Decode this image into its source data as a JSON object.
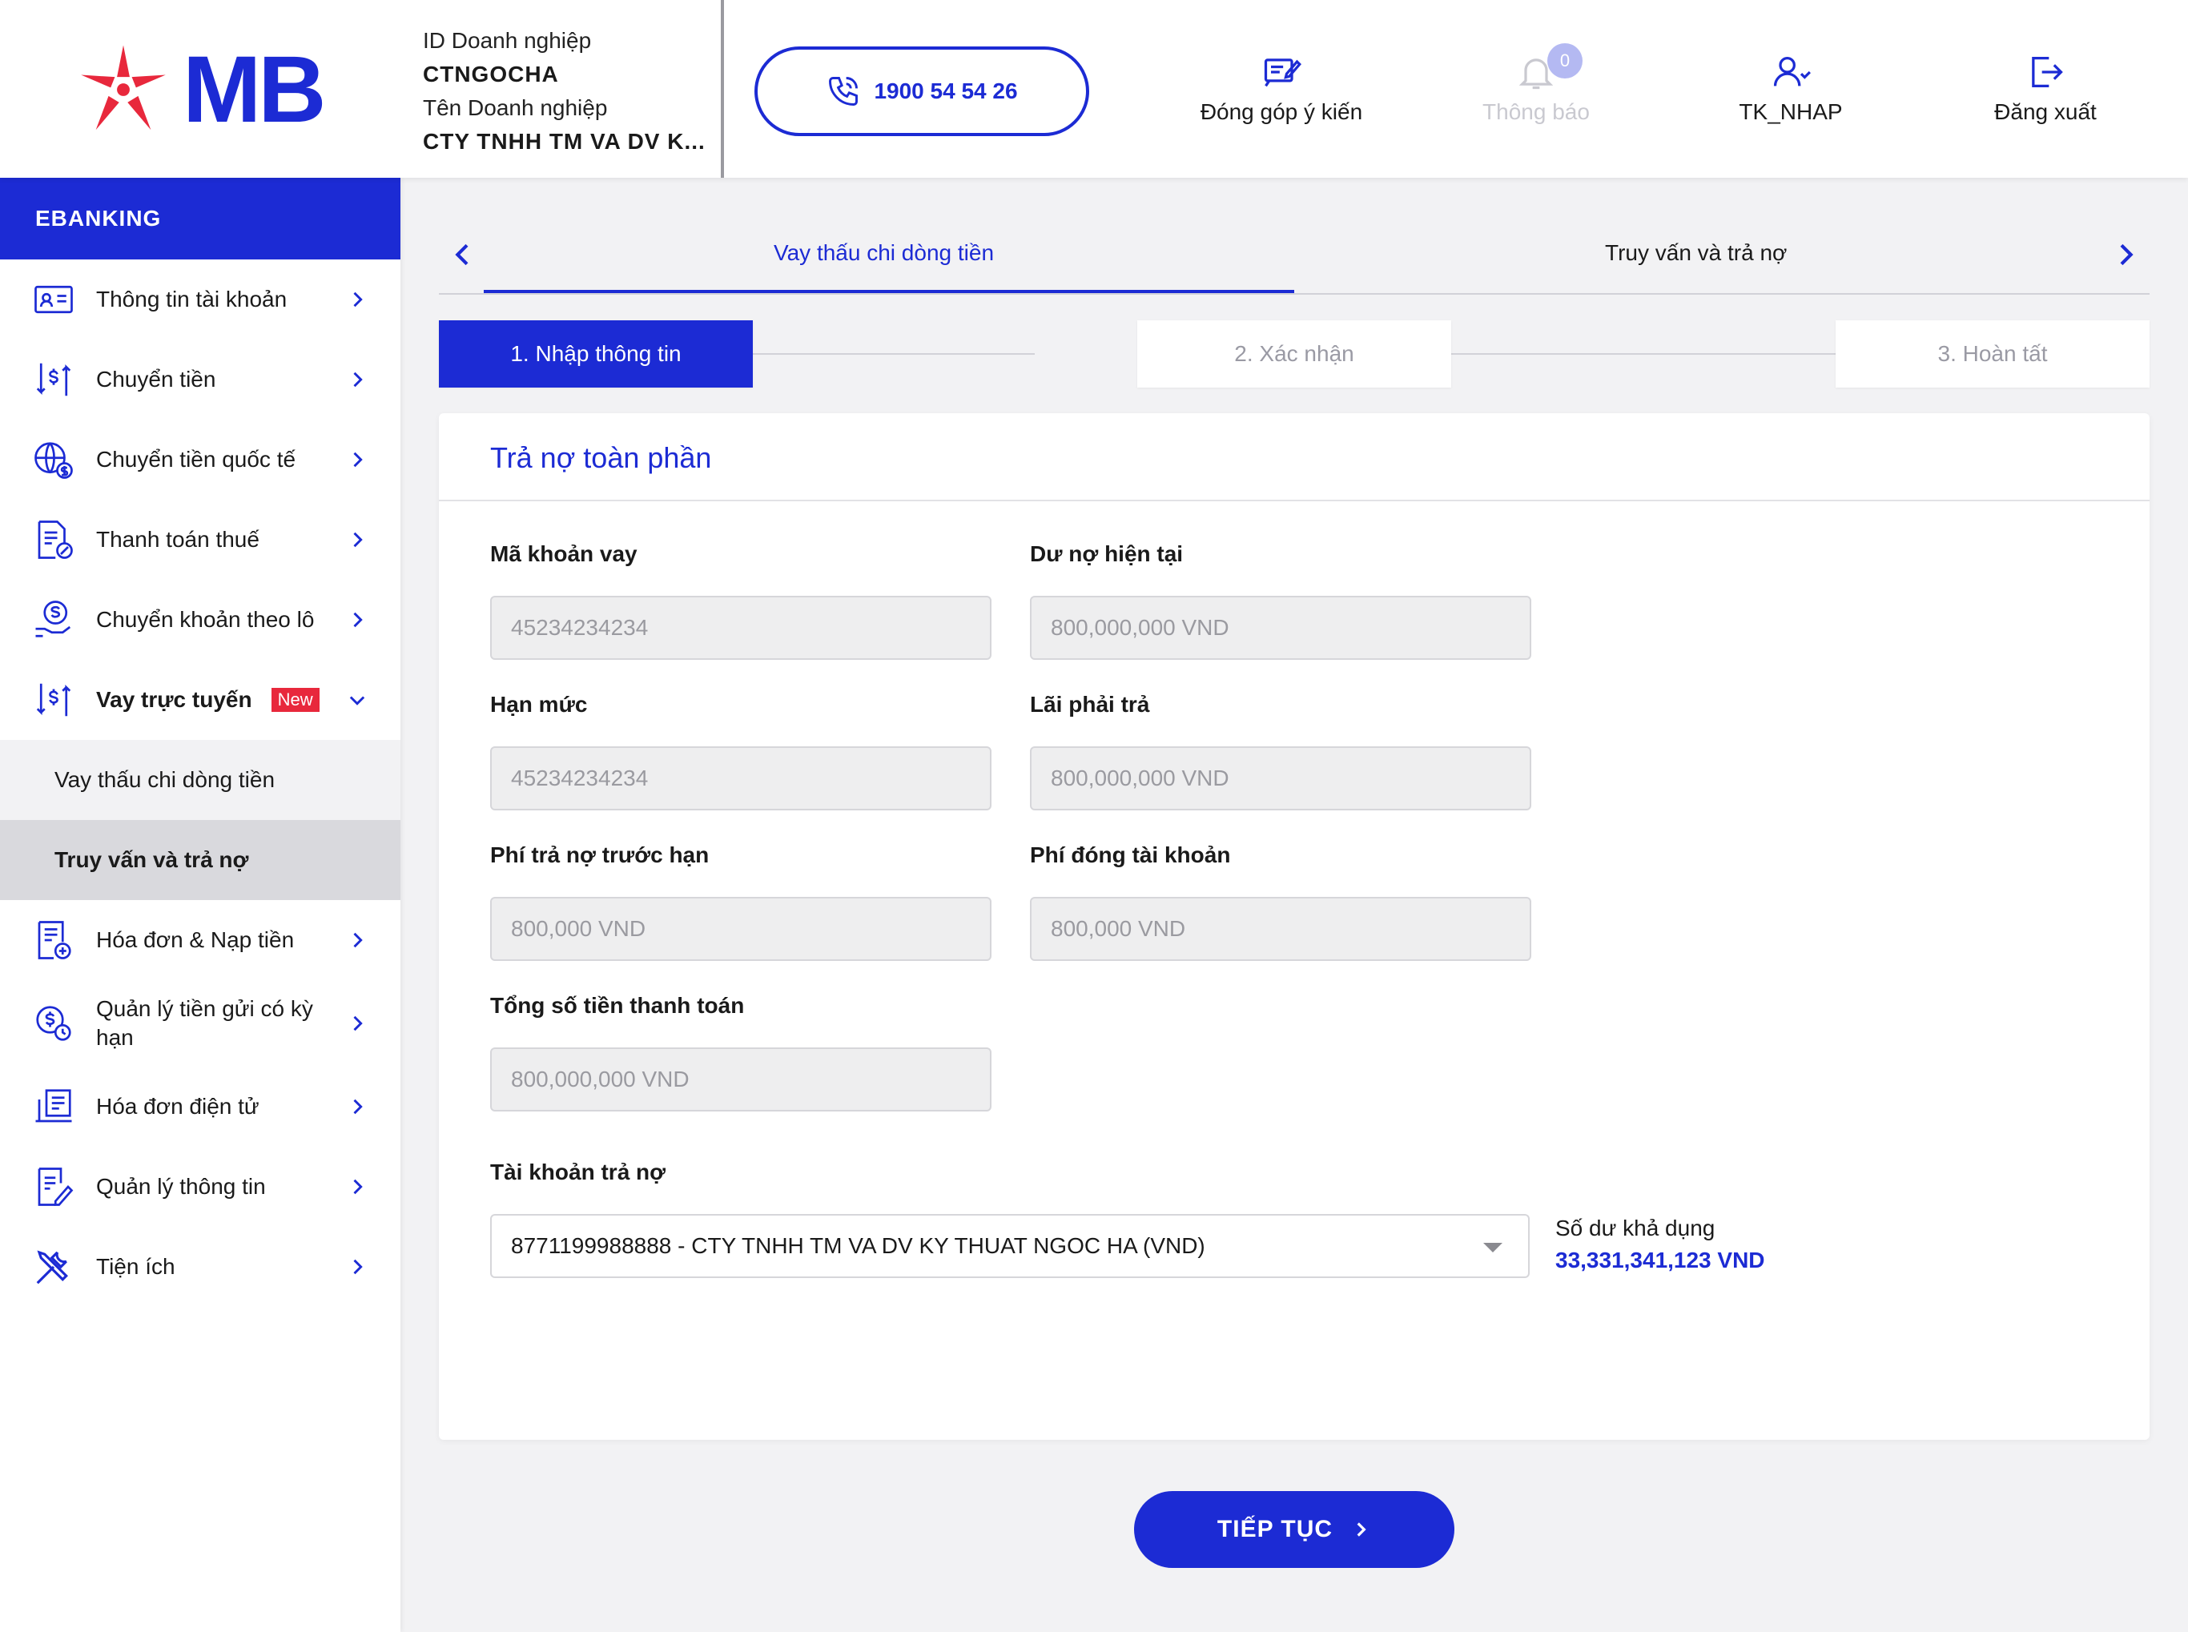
{
  "brand": {
    "logo_text": "MB",
    "primary": "#1c2bd4",
    "accent": "#e8283c"
  },
  "header": {
    "business_id_label": "ID Doanh nghiệp",
    "business_id": "CTNGOCHA",
    "business_name_label": "Tên Doanh nghiệp",
    "business_name": "CTY TNHH TM VA DV K...",
    "hotline": "1900 54 54 26",
    "feedback": "Đóng góp ý kiến",
    "notifications": "Thông báo",
    "notification_count": "0",
    "user": "TK_NHAP",
    "logout": "Đăng xuất"
  },
  "sidebar": {
    "section": "EBANKING",
    "items": [
      {
        "label": "Thông tin tài khoản",
        "icon": "id-card-icon"
      },
      {
        "label": "Chuyển tiền",
        "icon": "transfer-icon"
      },
      {
        "label": "Chuyển tiền quốc tế",
        "icon": "globe-dollar-icon"
      },
      {
        "label": "Thanh toán thuế",
        "icon": "tax-doc-icon"
      },
      {
        "label": "Chuyển khoản theo lô",
        "icon": "hand-coin-icon"
      },
      {
        "label": "Vay trực tuyến",
        "icon": "loan-icon",
        "tag": "New"
      },
      {
        "label": "Hóa đơn & Nạp tiền",
        "icon": "bill-icon"
      },
      {
        "label": "Quản lý tiền gửi có kỳ hạn",
        "icon": "deposit-icon"
      },
      {
        "label": "Hóa đơn điện tử",
        "icon": "ebill-icon"
      },
      {
        "label": "Quản lý thông tin",
        "icon": "edit-doc-icon"
      },
      {
        "label": "Tiện ích",
        "icon": "tools-icon"
      }
    ],
    "sub_items": [
      {
        "label": "Vay thấu chi dòng tiền"
      },
      {
        "label": "Truy vấn và trả nợ"
      }
    ]
  },
  "tabs": [
    {
      "label": "Vay thấu chi dòng tiền",
      "active": true
    },
    {
      "label": "Truy vấn và trả nợ",
      "active": false
    }
  ],
  "steps": [
    {
      "label": "1. Nhập thông tin",
      "active": true
    },
    {
      "label": "2. Xác nhận",
      "active": false
    },
    {
      "label": "3. Hoàn tất",
      "active": false
    }
  ],
  "form": {
    "title": "Trả nợ toàn phần",
    "fields": [
      {
        "label": "Mã khoản vay",
        "value": "45234234234"
      },
      {
        "label": "Dư nợ hiện tại",
        "value": "800,000,000 VND"
      },
      {
        "label": "Hạn mức",
        "value": "45234234234"
      },
      {
        "label": "Lãi phải trả",
        "value": "800,000,000 VND"
      },
      {
        "label": "Phí trả nợ trước hạn",
        "value": "800,000 VND"
      },
      {
        "label": "Phí đóng tài khoản",
        "value": "800,000 VND"
      },
      {
        "label": "Tổng số tiền thanh toán",
        "value": "800,000,000 VND"
      }
    ],
    "account_label": "Tài khoản trả nợ",
    "account_value": "8771199988888 - CTY TNHH TM VA DV KY THUAT NGOC HA (VND)",
    "balance_label": "Số dư khả dụng",
    "balance_value": "33,331,341,123 VND"
  },
  "actions": {
    "next": "TIẾP TỤC"
  }
}
